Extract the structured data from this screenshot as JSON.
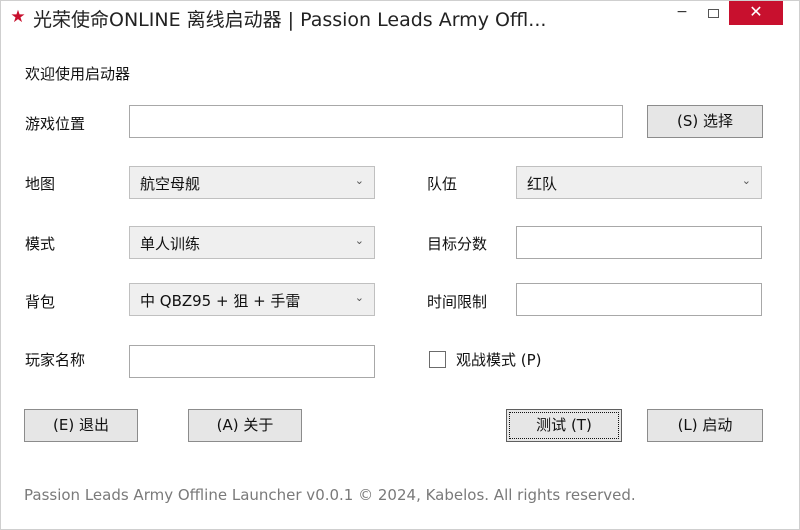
{
  "window": {
    "title": "光荣使命ONLINE 离线启动器 | Passion Leads Army Offl...",
    "icon": "star-icon",
    "minimize_glyph": "−",
    "close_glyph": "✕"
  },
  "welcome_text": "欢迎使用启动器",
  "game_location": {
    "label": "游戏位置",
    "value": "",
    "browse_label": "(S) 选择"
  },
  "map": {
    "label": "地图",
    "value": "航空母舰"
  },
  "team": {
    "label": "队伍",
    "value": "红队"
  },
  "mode": {
    "label": "模式",
    "value": "单人训练"
  },
  "target_score": {
    "label": "目标分数",
    "value": ""
  },
  "backpack": {
    "label": "背包",
    "value": "中 QBZ95 + 狙 + 手雷"
  },
  "time_limit": {
    "label": "时间限制",
    "value": ""
  },
  "player_name": {
    "label": "玩家名称",
    "value": ""
  },
  "spectator": {
    "label": "观战模式 (P)",
    "checked": false
  },
  "buttons": {
    "exit": "(E) 退出",
    "about": "(A) 关于",
    "test": "测试 (T)",
    "launch": "(L) 启动"
  },
  "footer": "Passion Leads Army Offline Launcher v0.0.1 © 2024, Kabelos. All rights reserved.",
  "colors": {
    "accent_red": "#c8102e",
    "footer_gray": "#7a7a7a"
  }
}
